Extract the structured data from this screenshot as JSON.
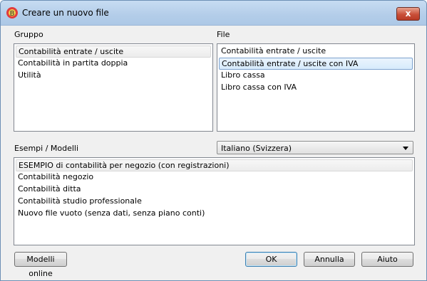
{
  "window": {
    "title": "Creare un nuovo file",
    "close_label": "x"
  },
  "gruppo": {
    "label": "Gruppo",
    "items": [
      "Contabilità entrate / uscite",
      "Contabilità in partita doppia",
      "Utilità"
    ]
  },
  "file": {
    "label": "File",
    "items": [
      "Contabilità entrate / uscite",
      "Contabilità entrate / uscite con IVA",
      "Libro cassa",
      "Libro cassa con IVA"
    ]
  },
  "esempi": {
    "label": "Esempi / Modelli",
    "language": "Italiano (Svizzera)",
    "items": [
      "ESEMPIO di contabilità per negozio (con registrazioni)",
      "Contabilità negozio",
      "Contabilità ditta",
      "Contabilità studio professionale",
      "Nuovo file vuoto (senza dati, senza piano conti)"
    ]
  },
  "buttons": {
    "online": "Modelli online",
    "ok": "OK",
    "cancel": "Annulla",
    "help": "Aiuto"
  },
  "colors": {
    "accent": "#7da2ce",
    "close": "#c94f38"
  }
}
